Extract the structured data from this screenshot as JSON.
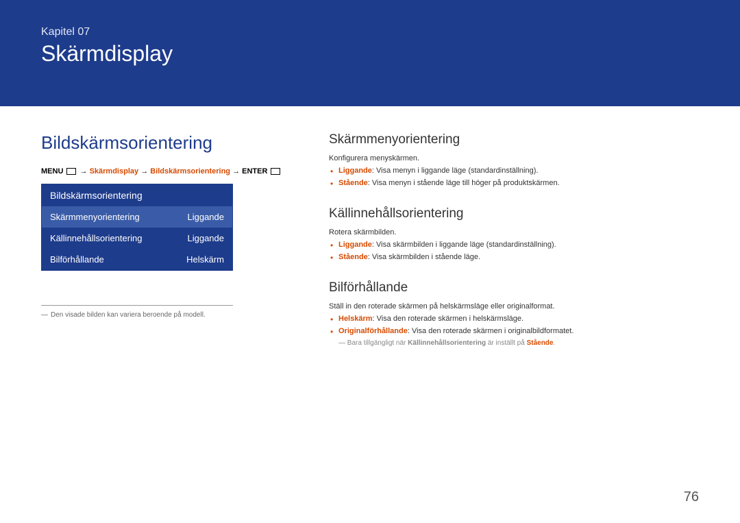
{
  "header": {
    "chapter_label": "Kapitel 07",
    "chapter_title": "Skärmdisplay"
  },
  "left": {
    "section_title": "Bildskärmsorientering",
    "breadcrumb": {
      "menu": "MENU",
      "arrow": "→",
      "part1": "Skärmdisplay",
      "part2": "Bildskärmsorientering",
      "enter": "ENTER"
    },
    "menu": {
      "header": "Bildskärmsorientering",
      "rows": [
        {
          "label": "Skärmmenyorientering",
          "value": "Liggande"
        },
        {
          "label": "Källinnehållsorientering",
          "value": "Liggande"
        },
        {
          "label": "Bilförhållande",
          "value": "Helskärm"
        }
      ]
    },
    "footnote": "Den visade bilden kan variera beroende på modell."
  },
  "right": {
    "sec1": {
      "title": "Skärmmenyorientering",
      "intro": "Konfigurera menyskärmen.",
      "items": [
        {
          "term": "Liggande",
          "desc": ": Visa menyn i liggande läge (standardinställning)."
        },
        {
          "term": "Stående",
          "desc": ": Visa menyn i stående läge till höger på produktskärmen."
        }
      ]
    },
    "sec2": {
      "title": "Källinnehållsorientering",
      "intro": "Rotera skärmbilden.",
      "items": [
        {
          "term": "Liggande",
          "desc": ": Visa skärmbilden i liggande läge (standardinställning)."
        },
        {
          "term": "Stående",
          "desc": ": Visa skärmbilden i stående läge."
        }
      ]
    },
    "sec3": {
      "title": "Bilförhållande",
      "intro": "Ställ in den roterade skärmen på helskärmsläge eller originalformat.",
      "items": [
        {
          "term": "Helskärm",
          "desc": ": Visa den roterade skärmen i helskärmsläge."
        },
        {
          "term": "Originalförhållande",
          "desc": ": Visa den roterade skärmen i originalbildformatet."
        }
      ],
      "footnote_pre": "Bara tillgängligt när ",
      "footnote_bold": "Källinnehållsorientering",
      "footnote_mid": " är inställt på ",
      "footnote_orange": "Stående",
      "footnote_end": "."
    }
  },
  "page_number": "76"
}
